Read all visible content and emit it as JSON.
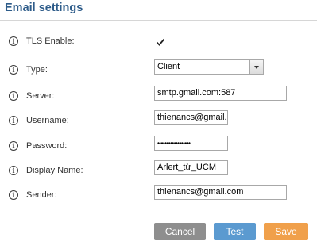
{
  "page": {
    "title": "Email settings"
  },
  "fields": {
    "tls": {
      "label": "TLS Enable:",
      "checked": true
    },
    "type": {
      "label": "Type:",
      "value": "Client"
    },
    "server": {
      "label": "Server:",
      "value": "smtp.gmail.com:587"
    },
    "username": {
      "label": "Username:",
      "value": "thienancs@gmail.c"
    },
    "password": {
      "label": "Password:",
      "value": "••••••••••••••••••"
    },
    "display_name": {
      "label": "Display Name:",
      "value": "Arlert_từ_UCM"
    },
    "sender": {
      "label": "Sender:",
      "value": "thienancs@gmail.com"
    }
  },
  "buttons": {
    "cancel": "Cancel",
    "test": "Test",
    "save": "Save"
  },
  "icons": {
    "info": "info-icon",
    "check": "check-icon",
    "dropdown": "chevron-down-icon"
  },
  "colors": {
    "title": "#2e5c8a",
    "cancel": "#8e8e8e",
    "test": "#5b9ad0",
    "save": "#f0a04b"
  }
}
